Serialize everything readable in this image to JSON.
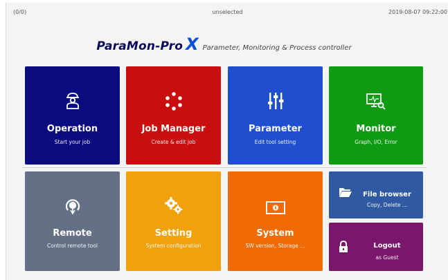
{
  "status": {
    "counter": "(0/0)",
    "selection": "unselected",
    "datetime": "2019-08-07 09:22:00"
  },
  "brand": {
    "name": "ParaMon-Pro",
    "x": "X",
    "tagline": "Parameter, Monitoring & Process controller"
  },
  "tiles": {
    "operation": {
      "title": "Operation",
      "sub": "Start your job",
      "icon": "worker-icon",
      "color": "#0b0b80"
    },
    "job_manager": {
      "title": "Job Manager",
      "sub": "Create & edit job",
      "icon": "job-network-icon",
      "color": "#c80e0e"
    },
    "parameter": {
      "title": "Parameter",
      "sub": "Edit tool setting",
      "icon": "sliders-icon",
      "color": "#1f4fcf"
    },
    "monitor": {
      "title": "Monitor",
      "sub": "Graph, I/O, Error",
      "icon": "monitor-search-icon",
      "color": "#0f9a14"
    },
    "remote": {
      "title": "Remote",
      "sub": "Control remote tool",
      "icon": "remote-touch-icon",
      "color": "#637085"
    },
    "setting": {
      "title": "Setting",
      "sub": "System configuration",
      "icon": "gears-icon",
      "color": "#f0a10b"
    },
    "system": {
      "title": "System",
      "sub": "SW version, Storage ...",
      "icon": "system-info-icon",
      "color": "#f06b06"
    },
    "file_browser": {
      "title": "File browser",
      "sub": "Copy, Delete ...",
      "icon": "folder-icon",
      "color": "#2f5aa1"
    },
    "logout": {
      "title": "Logout",
      "sub": "as Guest",
      "icon": "lock-icon",
      "color": "#7a176b"
    }
  }
}
